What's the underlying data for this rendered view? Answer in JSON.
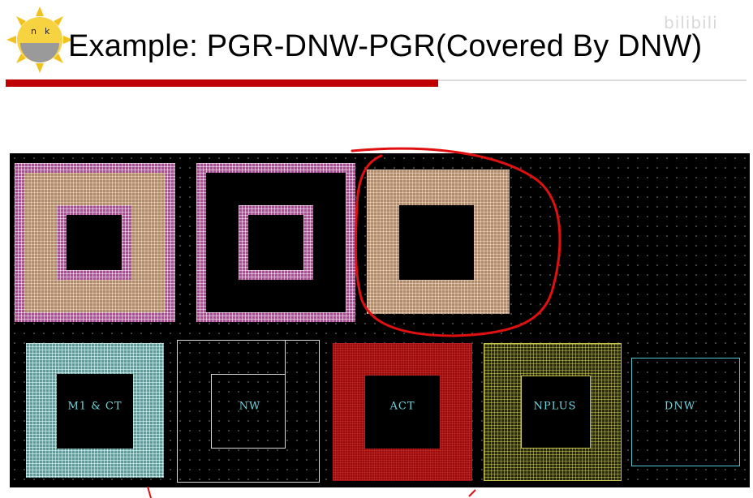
{
  "header": {
    "title": "Example: PGR-DNW-PGR(Covered By DNW)",
    "watermark": "bilibili",
    "accent_color": "#c00000"
  },
  "logo": {
    "icon": "sun-face-icon",
    "letters": [
      "n",
      "k"
    ]
  },
  "layout_view": {
    "background": "#000000",
    "structures": [
      {
        "name": "pgr-structure-1",
        "color": "#b04a98"
      },
      {
        "name": "pgr-structure-2",
        "color": "#b04a98"
      },
      {
        "name": "pgr-structure-3",
        "color": "#b08a6a",
        "highlighted": true
      }
    ],
    "layers": [
      {
        "label": "M1  &  CT",
        "color": "#5f9c9a"
      },
      {
        "label": "NW",
        "color": "#d8d8d8"
      },
      {
        "label": "ACT",
        "color": "#9a0c0c"
      },
      {
        "label": "NPLUS",
        "color": "#c8c44a"
      },
      {
        "label": "DNW",
        "color": "#56c8d0"
      }
    ],
    "annotation_color": "#e01010"
  }
}
